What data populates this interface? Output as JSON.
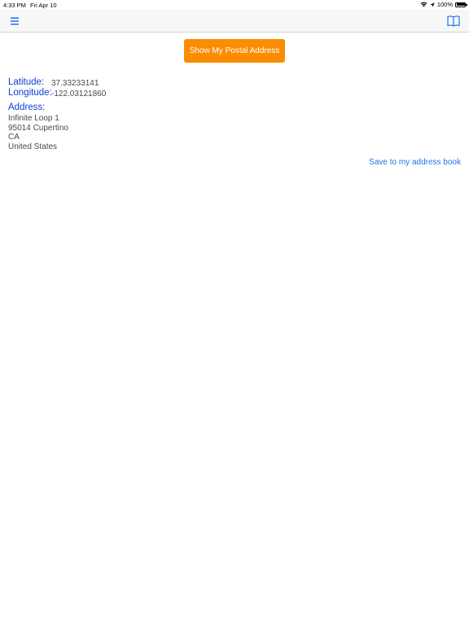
{
  "status_bar": {
    "time": "4:33 PM",
    "date": "Fri Apr 10",
    "battery_percent": "100%",
    "icons": [
      "wifi-icon",
      "location-arrow-icon",
      "battery-icon"
    ]
  },
  "nav_bar": {
    "left_icon": "menu-icon",
    "right_icon": "book-icon",
    "accent_color": "#1a73e8"
  },
  "main": {
    "show_address_button": "Show My Postal Address",
    "button_color": "#fb8c00",
    "latitude_label": "Latitude:",
    "latitude_value": "37.33233141",
    "longitude_label": "Longitude:",
    "longitude_value": "-122.03121860",
    "address_label": "Address:",
    "address_lines": [
      "Infinite Loop 1",
      "95014 Cupertino",
      "CA",
      "United States"
    ],
    "save_link": "Save to my address book"
  }
}
